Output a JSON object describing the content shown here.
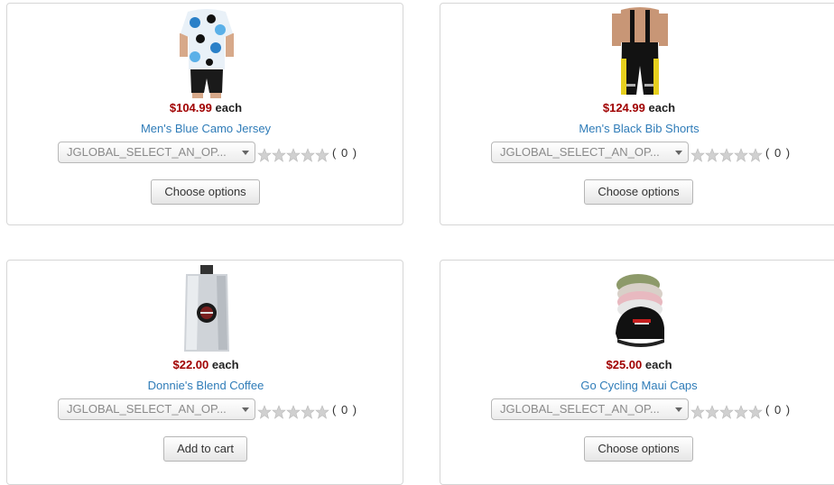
{
  "products": [
    {
      "price": "$104.99",
      "each": "each",
      "name": "Men's Blue Camo Jersey",
      "select": "JGLOBAL_SELECT_AN_OP...",
      "rating_count": "( 0 )",
      "rating": 0,
      "button": "Choose options",
      "image": "blue-camo-jersey-photo"
    },
    {
      "price": "$124.99",
      "each": "each",
      "name": "Men's Black Bib Shorts",
      "select": "JGLOBAL_SELECT_AN_OP...",
      "rating_count": "( 0 )",
      "rating": 0,
      "button": "Choose options",
      "image": "black-bib-shorts-photo"
    },
    {
      "price": "$22.00",
      "each": "each",
      "name": "Donnie's Blend Coffee",
      "select": "JGLOBAL_SELECT_AN_OP...",
      "rating_count": "( 0 )",
      "rating": 0,
      "button": "Add to cart",
      "image": "coffee-bag-photo"
    },
    {
      "price": "$25.00",
      "each": "each",
      "name": "Go Cycling Maui Caps",
      "select": "JGLOBAL_SELECT_AN_OP...",
      "rating_count": "( 0 )",
      "rating": 0,
      "button": "Choose options",
      "image": "cycling-caps-photo"
    }
  ],
  "colors": {
    "price": "#a00000",
    "link": "#2f7cb8",
    "border": "#d6d6d6",
    "star_empty": "#d0d0d0"
  }
}
